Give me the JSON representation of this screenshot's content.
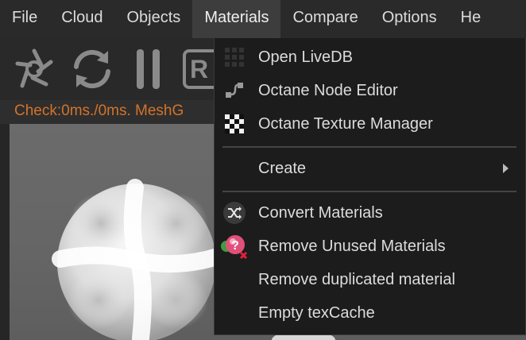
{
  "menubar": {
    "items": [
      "File",
      "Cloud",
      "Objects",
      "Materials",
      "Compare",
      "Options",
      "He"
    ],
    "active_index": 3
  },
  "toolbar": {
    "icons": [
      "aperture-icon",
      "refresh-icon",
      "pause-icon",
      "render-region-icon"
    ],
    "partial_button_text": "R"
  },
  "status": {
    "text": "Check:0ms./0ms. MeshG",
    "color": "#d4732a"
  },
  "materials_menu": {
    "items": [
      {
        "label": "Open LiveDB",
        "icon": "livedb-grid-icon"
      },
      {
        "label": "Octane Node Editor",
        "icon": "node-editor-icon"
      },
      {
        "label": "Octane Texture Manager",
        "icon": "checker-texture-icon"
      },
      {
        "label": "Create",
        "icon": "",
        "submenu": true
      },
      {
        "label": "Convert Materials",
        "icon": "convert-shuffle-icon"
      },
      {
        "label": "Remove Unused Materials",
        "icon": "remove-unused-icon"
      },
      {
        "label": "Remove duplicated material",
        "icon": ""
      },
      {
        "label": "Empty texCache",
        "icon": ""
      }
    ]
  },
  "colors": {
    "menubar_bg": "#2a2a2a",
    "menu_active_bg": "#3d3d3d",
    "dropdown_bg": "#1c1c1c",
    "status_text": "#d4732a"
  }
}
